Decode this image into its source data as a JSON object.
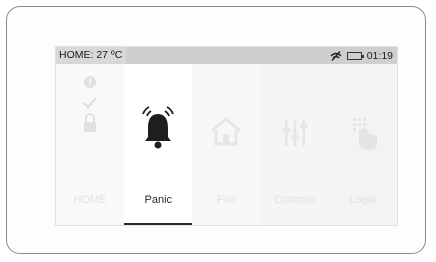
{
  "status_bar": {
    "text": "HOME: 27 ºC",
    "time": "01:19",
    "icons": [
      "signal-off-icon",
      "battery-icon"
    ]
  },
  "tiles": [
    {
      "label": "HOME",
      "icon": "status-icons",
      "selected": false
    },
    {
      "label": "Panic",
      "icon": "bell-icon",
      "selected": true
    },
    {
      "label": "Fire",
      "icon": "house-icon",
      "selected": false
    },
    {
      "label": "Controls",
      "icon": "sliders-icon",
      "selected": false
    },
    {
      "label": "Login",
      "icon": "keypad-touch-icon",
      "selected": false
    }
  ],
  "colors": {
    "status_bar": "#cfcfcf",
    "selected_underline": "#2b2b2b",
    "active_text": "#2a2a2a",
    "inactive_text": "#e2e2e2"
  }
}
